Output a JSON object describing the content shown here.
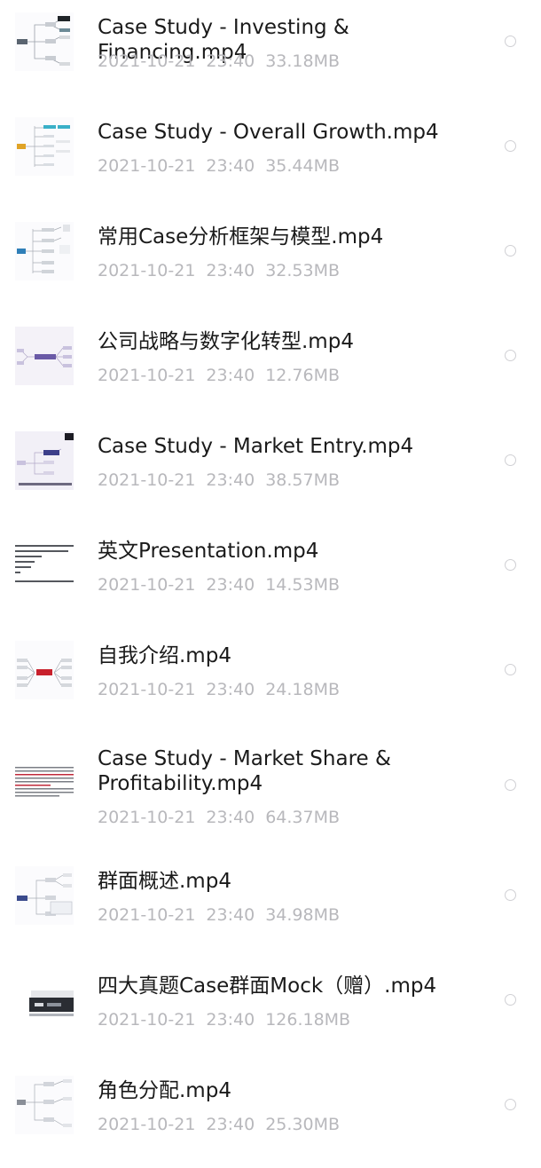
{
  "files": [
    {
      "name": "Case Study - Investing & Financing.mp4",
      "date": "2021-10-21",
      "time": "23:40",
      "size": "33.18MB",
      "thumb": "mindmap-dark"
    },
    {
      "name": "Case Study - Overall Growth.mp4",
      "date": "2021-10-21",
      "time": "23:40",
      "size": "35.44MB",
      "thumb": "mindmap-color"
    },
    {
      "name": "常用Case分析框架与模型.mp4",
      "date": "2021-10-21",
      "time": "23:40",
      "size": "32.53MB",
      "thumb": "mindmap-blue"
    },
    {
      "name": "公司战略与数字化转型.mp4",
      "date": "2021-10-21",
      "time": "23:40",
      "size": "12.76MB",
      "thumb": "mindmap-purple"
    },
    {
      "name": "Case Study - Market Entry.mp4",
      "date": "2021-10-21",
      "time": "23:40",
      "size": "38.57MB",
      "thumb": "mindmap-purple-dark"
    },
    {
      "name": "英文Presentation.mp4",
      "date": "2021-10-21",
      "time": "23:40",
      "size": "14.53MB",
      "thumb": "text-document"
    },
    {
      "name": "自我介绍.mp4",
      "date": "2021-10-21",
      "time": "23:40",
      "size": "24.18MB",
      "thumb": "mindmap-red"
    },
    {
      "name": "Case Study - Market Share &\nProfitability.mp4",
      "date": "2021-10-21",
      "time": "23:40",
      "size": "64.37MB",
      "thumb": "text-red"
    },
    {
      "name": "群面概述.mp4",
      "date": "2021-10-21",
      "time": "23:40",
      "size": "34.98MB",
      "thumb": "mindmap-navy"
    },
    {
      "name": "四大真题Case群面Mock（赠）.mp4",
      "date": "2021-10-21",
      "time": "23:40",
      "size": "126.18MB",
      "thumb": "video-dark"
    },
    {
      "name": "角色分配.mp4",
      "date": "2021-10-21",
      "time": "23:40",
      "size": "25.30MB",
      "thumb": "mindmap-gray"
    }
  ]
}
